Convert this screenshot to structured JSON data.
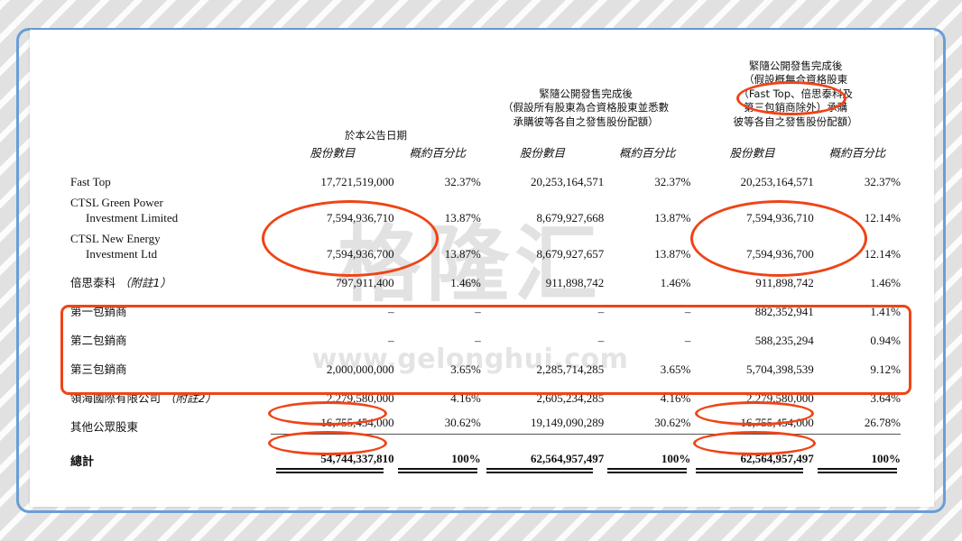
{
  "document": {
    "watermark_logo": "格隆汇",
    "watermark_url": "www.gelonghui.com"
  },
  "table": {
    "headers": {
      "col_group_1": "於本公告日期",
      "col_group_2_line1": "緊隨公開發售完成後",
      "col_group_2_line2": "（假設所有股東為合資格股東並悉數",
      "col_group_2_line3": "承購彼等各自之發售股份配額）",
      "col_group_3_line1": "緊隨公開發售完成後",
      "col_group_3_line2": "（假設概無合資格股東",
      "col_group_3_line3": "（Fast Top、倍思泰科及",
      "col_group_3_line4": "第三包銷商除外）承購",
      "col_group_3_line5": "彼等各自之發售股份配額）",
      "shares_1": "股份數目",
      "percent_1": "概約百分比",
      "shares_2": "股份數目",
      "percent_2": "概約百分比",
      "shares_3": "股份數目",
      "percent_3": "概約百分比"
    },
    "rows": [
      {
        "label": "Fast Top",
        "label2": "",
        "note": "",
        "shares_1": "17,721,519,000",
        "percent_1": "32.37%",
        "shares_2": "20,253,164,571",
        "percent_2": "32.37%",
        "shares_3": "20,253,164,571",
        "percent_3": "32.37%"
      },
      {
        "label": "CTSL Green Power",
        "label2": "Investment Limited",
        "note": "",
        "shares_1": "7,594,936,710",
        "percent_1": "13.87%",
        "shares_2": "8,679,927,668",
        "percent_2": "13.87%",
        "shares_3": "7,594,936,710",
        "percent_3": "12.14%"
      },
      {
        "label": "CTSL New Energy",
        "label2": "Investment Ltd",
        "note": "",
        "shares_1": "7,594,936,700",
        "percent_1": "13.87%",
        "shares_2": "8,679,927,657",
        "percent_2": "13.87%",
        "shares_3": "7,594,936,700",
        "percent_3": "12.14%"
      },
      {
        "label": "倍思泰科 ",
        "label2": "",
        "note": "（附註1）",
        "shares_1": "797,911,400",
        "percent_1": "1.46%",
        "shares_2": "911,898,742",
        "percent_2": "1.46%",
        "shares_3": "911,898,742",
        "percent_3": "1.46%"
      },
      {
        "label": "第一包銷商",
        "label2": "",
        "note": "",
        "shares_1": "–",
        "percent_1": "–",
        "shares_2": "–",
        "percent_2": "–",
        "shares_3": "882,352,941",
        "percent_3": "1.41%"
      },
      {
        "label": "第二包銷商",
        "label2": "",
        "note": "",
        "shares_1": "–",
        "percent_1": "–",
        "shares_2": "–",
        "percent_2": "–",
        "shares_3": "588,235,294",
        "percent_3": "0.94%"
      },
      {
        "label": "第三包銷商",
        "label2": "",
        "note": "",
        "shares_1": "2,000,000,000",
        "percent_1": "3.65%",
        "shares_2": "2,285,714,285",
        "percent_2": "3.65%",
        "shares_3": "5,704,398,539",
        "percent_3": "9.12%"
      },
      {
        "label": "領海國際有限公司 ",
        "label2": "",
        "note": "（附註2）",
        "shares_1": "2,279,580,000",
        "percent_1": "4.16%",
        "shares_2": "2,605,234,285",
        "percent_2": "4.16%",
        "shares_3": "2,279,580,000",
        "percent_3": "3.64%"
      },
      {
        "label": "其他公眾股東",
        "label2": "",
        "note": "",
        "shares_1": "16,755,454,000",
        "percent_1": "30.62%",
        "shares_2": "19,149,090,289",
        "percent_2": "30.62%",
        "shares_3": "16,755,454,000",
        "percent_3": "26.78%"
      }
    ],
    "total": {
      "label": "總計",
      "shares_1": "54,744,337,810",
      "percent_1": "100%",
      "shares_2": "62,564,957,497",
      "percent_2": "100%",
      "shares_3": "62,564,957,497",
      "percent_3": "100%"
    }
  },
  "annotations": {
    "accent_color": "#ef4416",
    "frame_color": "#6a9ed6"
  }
}
